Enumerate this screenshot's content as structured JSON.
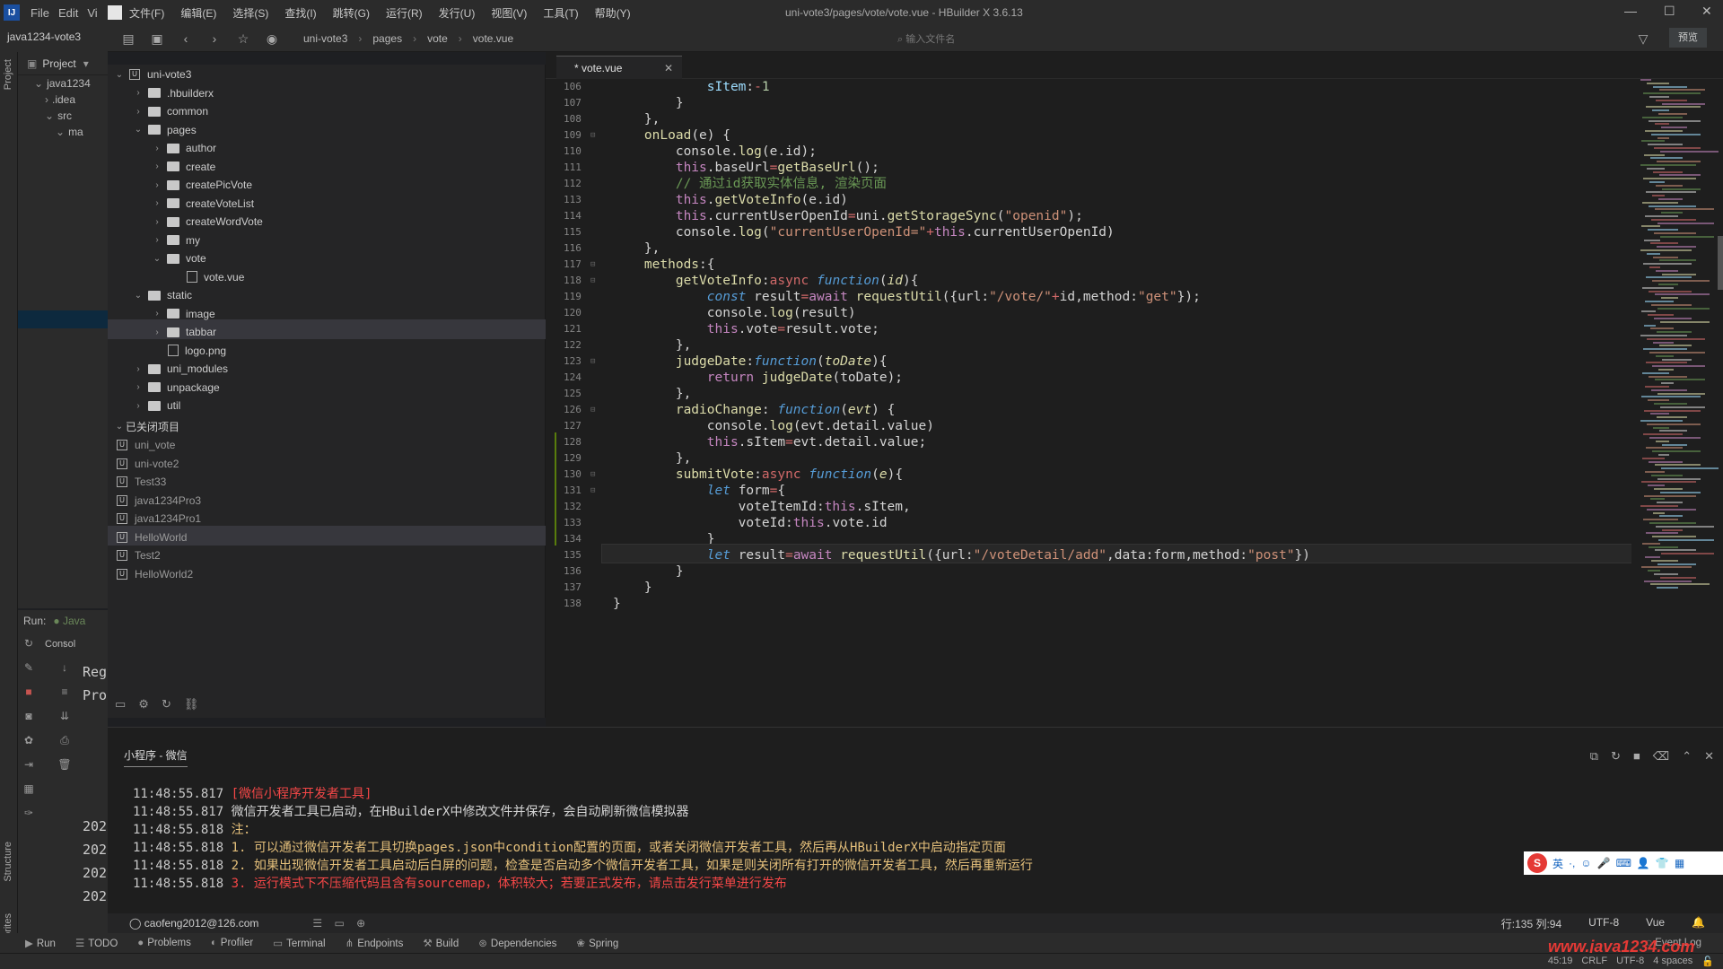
{
  "ij": {
    "logo": "IJ",
    "menu": [
      "File",
      "Edit",
      "Vi"
    ],
    "project_label": "java1234-vote3",
    "project_tab": "Project",
    "project_root": "java1234",
    "project_rows": [
      ".idea",
      "src",
      "ma"
    ],
    "left_vertical_tabs": [
      "Project",
      "Structure",
      "Favorites"
    ],
    "run_label": "Run:",
    "run_tab": "Java",
    "console_tab": "Consol",
    "run_lines": [
      "Reg",
      "Pro",
      "202",
      "202",
      "202",
      "202"
    ],
    "bottom_tools": [
      {
        "label": "Run",
        "icon": "play-icon"
      },
      {
        "label": "TODO",
        "icon": "list-icon"
      },
      {
        "label": "Problems",
        "icon": "problems-icon"
      },
      {
        "label": "Profiler",
        "icon": "profiler-icon"
      },
      {
        "label": "Terminal",
        "icon": "terminal-icon"
      },
      {
        "label": "Endpoints",
        "icon": "endpoints-icon"
      },
      {
        "label": "Build",
        "icon": "build-icon"
      },
      {
        "label": "Dependencies",
        "icon": "dependencies-icon"
      },
      {
        "label": "Spring",
        "icon": "spring-icon"
      }
    ],
    "event_log": "Event Log",
    "status_right": [
      "45:19",
      "CRLF",
      "UTF-8",
      "4 spaces"
    ]
  },
  "hb": {
    "menu": [
      "文件(F)",
      "编辑(E)",
      "选择(S)",
      "查找(I)",
      "跳转(G)",
      "运行(R)",
      "发行(U)",
      "视图(V)",
      "工具(T)",
      "帮助(Y)"
    ],
    "window_title": "uni-vote3/pages/vote/vote.vue - HBuilder X 3.6.13",
    "breadcrumb": [
      "uni-vote3",
      "pages",
      "vote",
      "vote.vue"
    ],
    "search_placeholder": "输入文件名",
    "preview_label": "预览",
    "tab_label": "* vote.vue",
    "tree": {
      "root": "uni-vote3",
      "items": [
        {
          "label": ".hbuilderx",
          "depth": 1,
          "type": "folder",
          "open": false
        },
        {
          "label": "common",
          "depth": 1,
          "type": "folder",
          "open": false
        },
        {
          "label": "pages",
          "depth": 1,
          "type": "folder",
          "open": true
        },
        {
          "label": "author",
          "depth": 2,
          "type": "folder",
          "open": false
        },
        {
          "label": "create",
          "depth": 2,
          "type": "folder",
          "open": false
        },
        {
          "label": "createPicVote",
          "depth": 2,
          "type": "folder",
          "open": false
        },
        {
          "label": "createVoteList",
          "depth": 2,
          "type": "folder",
          "open": false
        },
        {
          "label": "createWordVote",
          "depth": 2,
          "type": "folder",
          "open": false
        },
        {
          "label": "my",
          "depth": 2,
          "type": "folder",
          "open": false
        },
        {
          "label": "vote",
          "depth": 2,
          "type": "folder",
          "open": true
        },
        {
          "label": "vote.vue",
          "depth": 3,
          "type": "file",
          "selected": true
        },
        {
          "label": "static",
          "depth": 1,
          "type": "folder",
          "open": true
        },
        {
          "label": "image",
          "depth": 2,
          "type": "folder",
          "open": false
        },
        {
          "label": "tabbar",
          "depth": 2,
          "type": "folder",
          "open": false
        },
        {
          "label": "logo.png",
          "depth": 2,
          "type": "image"
        },
        {
          "label": "uni_modules",
          "depth": 1,
          "type": "folder",
          "open": false
        },
        {
          "label": "unpackage",
          "depth": 1,
          "type": "folder",
          "open": false
        },
        {
          "label": "util",
          "depth": 1,
          "type": "folder",
          "open": false
        }
      ],
      "closed_header": "已关闭项目",
      "closed_projects": [
        "uni_vote",
        "uni-vote2",
        "Test33",
        "java1234Pro3",
        "java1234Pro1",
        "HelloWorld",
        "Test2",
        "HelloWorld2"
      ]
    },
    "code_lines": [
      {
        "n": "106",
        "html": "            <span class='pr'>sItem</span>:<span class='op'>-</span><span class='n'>1</span>"
      },
      {
        "n": "107",
        "html": "        }"
      },
      {
        "n": "108",
        "html": "    },"
      },
      {
        "n": "109",
        "fold": true,
        "html": "    <span class='f'>onLoad</span>(e) {"
      },
      {
        "n": "110",
        "html": "        console.<span class='f'>log</span>(e.id);"
      },
      {
        "n": "111",
        "html": "        <span class='th'>this</span>.baseUrl<span class='op'>=</span><span class='f'>getBaseUrl</span>();"
      },
      {
        "n": "112",
        "html": "        <span class='c'>// 通过id获取实体信息, 渲染页面</span>"
      },
      {
        "n": "113",
        "html": "        <span class='th'>this</span>.<span class='f'>getVoteInfo</span>(e.id)"
      },
      {
        "n": "114",
        "html": "        <span class='th'>this</span>.currentUserOpenId<span class='op'>=</span>uni.<span class='f'>getStorageSync</span>(<span class='s'>\"openid\"</span>);"
      },
      {
        "n": "115",
        "html": "        console.<span class='f'>log</span>(<span class='s'>\"currentUserOpenId=\"</span><span class='op'>+</span><span class='th'>this</span>.currentUserOpenId)"
      },
      {
        "n": "116",
        "html": "    },"
      },
      {
        "n": "117",
        "fold": true,
        "html": "    <span class='f'>methods</span>:{"
      },
      {
        "n": "118",
        "fold": true,
        "html": "        <span class='f'>getVoteInfo</span>:<span class='op'>async</span> <span class='it'>function</span>(<span class='pa'>id</span>){"
      },
      {
        "n": "119",
        "html": "            <span class='it'>const</span> result<span class='op'>=</span><span class='k'>await</span> <span class='f'>requestUtil</span>({url:<span class='s'>\"/vote/\"</span><span class='op'>+</span>id,method:<span class='s'>\"get\"</span>});"
      },
      {
        "n": "120",
        "html": "            console.<span class='f'>log</span>(result)"
      },
      {
        "n": "121",
        "html": "            <span class='th'>this</span>.vote<span class='op'>=</span>result.vote;"
      },
      {
        "n": "122",
        "html": "        },"
      },
      {
        "n": "123",
        "fold": true,
        "html": "        <span class='f'>judgeDate</span>:<span class='it'>function</span>(<span class='pa'>toDate</span>){"
      },
      {
        "n": "124",
        "html": "            <span class='k'>return</span> <span class='f'>judgeDate</span>(toDate);"
      },
      {
        "n": "125",
        "html": "        },"
      },
      {
        "n": "126",
        "fold": true,
        "html": "        <span class='f'>radioChange</span>: <span class='it'>function</span>(<span class='pa'>evt</span>) {"
      },
      {
        "n": "127",
        "html": "            console.<span class='f'>log</span>(evt.detail.value)"
      },
      {
        "n": "128",
        "html": "            <span class='th'>this</span>.sItem<span class='op'>=</span>evt.detail.value;"
      },
      {
        "n": "129",
        "html": "        },"
      },
      {
        "n": "130",
        "fold": true,
        "html": "        <span class='f'>submitVote</span>:<span class='op'>async</span> <span class='it'>function</span>(<span class='pa'>e</span>){"
      },
      {
        "n": "131",
        "fold": true,
        "html": "            <span class='it'>let</span> form<span class='op'>=</span>{"
      },
      {
        "n": "132",
        "html": "                voteItemId:<span class='th'>this</span>.sItem,"
      },
      {
        "n": "133",
        "html": "                voteId:<span class='th'>this</span>.vote.id"
      },
      {
        "n": "134",
        "html": "            }"
      },
      {
        "n": "135",
        "current": true,
        "html": "            <span class='it'>let</span> result<span class='op'>=</span><span class='k'>await</span> <span class='f'>requestUtil</span>({url:<span class='s'>\"/voteDetail/add\"</span>,data:form,method:<span class='s'>\"post\"</span>})"
      },
      {
        "n": "136",
        "html": "        }"
      },
      {
        "n": "137",
        "html": "    }"
      },
      {
        "n": "138",
        "html": "}"
      }
    ],
    "console": {
      "title": "小程序 - 微信",
      "lines": [
        {
          "time": "11:48:55.817",
          "text": "[微信小程序开发者工具]",
          "color": "#f44747"
        },
        {
          "time": "11:48:55.817",
          "text": "微信开发者工具已启动，在HBuilderX中修改文件并保存，会自动刷新微信模拟器",
          "color": "#d4d4d4"
        },
        {
          "time": "11:48:55.818",
          "text": "注：",
          "color": "#e5c07b"
        },
        {
          "time": "11:48:55.818",
          "text": "1. 可以通过微信开发者工具切换pages.json中condition配置的页面，或者关闭微信开发者工具，然后再从HBuilderX中启动指定页面",
          "color": "#e5c07b"
        },
        {
          "time": "11:48:55.818",
          "text": "2. 如果出现微信开发者工具启动后白屏的问题，检查是否启动多个微信开发者工具，如果是则关闭所有打开的微信开发者工具，然后再重新运行",
          "color": "#e5c07b"
        },
        {
          "time": "11:48:55.818",
          "text": "3. 运行模式下不压缩代码且含有sourcemap，体积较大；若要正式发布，请点击发行菜单进行发布",
          "color": "#f44747"
        }
      ],
      "ime_label": "英"
    },
    "status": {
      "user": "caofeng2012@126.com",
      "position": "行:135  列:94",
      "encoding": "UTF-8",
      "language": "Vue"
    },
    "watermark": "www.java1234.com"
  }
}
